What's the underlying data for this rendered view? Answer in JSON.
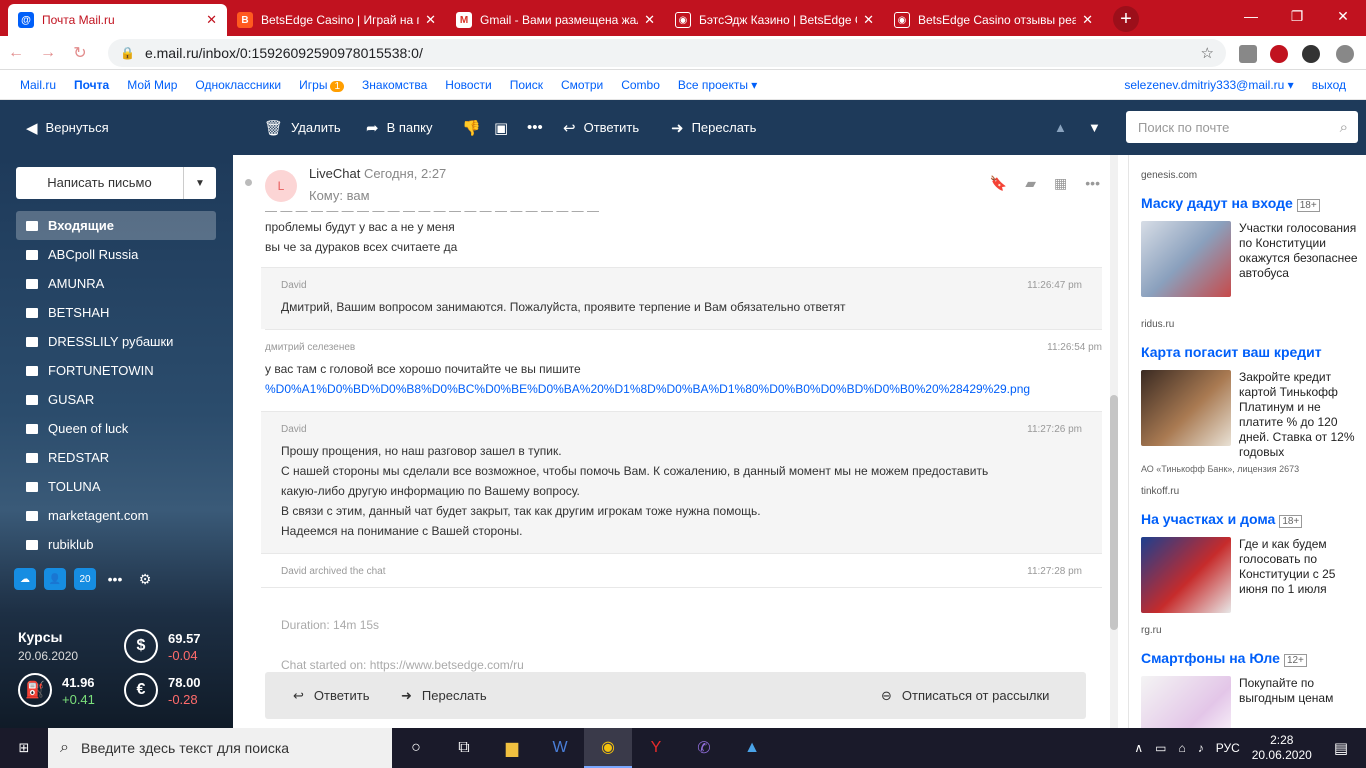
{
  "browser": {
    "tabs": [
      {
        "title": "Почта Mail.ru",
        "active": true,
        "color": "#005ff9",
        "icon": "@"
      },
      {
        "title": "BetsEdge Casino | Играй на по",
        "active": false,
        "color": "#ff5a1f",
        "icon": "B"
      },
      {
        "title": "Gmail - Вами размещена жалоб",
        "active": false,
        "color": "#ffffff",
        "icon": "M"
      },
      {
        "title": "БэтсЭдж Казино | BetsEdge Cas",
        "active": false,
        "color": "#c1121f",
        "icon": "◉"
      },
      {
        "title": "BetsEdge Casino отзывы реаль",
        "active": false,
        "color": "#c1121f",
        "icon": "◉"
      }
    ],
    "url": "e.mail.ru/inbox/0:15926092590978015538:0/"
  },
  "portal": {
    "links": [
      "Mail.ru",
      "Почта",
      "Мой Мир",
      "Одноклассники",
      "Игры",
      "Знакомства",
      "Новости",
      "Поиск",
      "Смотри",
      "Combo",
      "Все проекты ▾"
    ],
    "games_badge": "1",
    "user": "selezenev.dmitriy333@mail.ru ▾",
    "logout": "выход"
  },
  "toolbar": {
    "back": "Вернуться",
    "delete": "Удалить",
    "move": "В папку",
    "reply": "Ответить",
    "forward": "Переслать",
    "search_placeholder": "Поиск по почте"
  },
  "sidebar": {
    "compose": "Написать письмо",
    "folders": [
      "Входящие",
      "ABCpoll Russia",
      "AMUNRA",
      "BETSHAH",
      "DRESSLILY рубашки",
      "FORTUNETOWIN",
      "GUSAR",
      "Queen of luck",
      "REDSTAR",
      "TOLUNA",
      "marketagent.com",
      "rubiklub"
    ],
    "calendar_day": "20",
    "rates": {
      "title": "Курсы",
      "date": "20.06.2020",
      "usd": {
        "value": "69.57",
        "change": "-0.04"
      },
      "eur": {
        "value": "78.00",
        "change": "-0.28"
      },
      "oil": {
        "value": "41.96",
        "change": "+0.41"
      }
    }
  },
  "message": {
    "avatar": "L",
    "from": "LiveChat",
    "date": "Сегодня, 2:27",
    "to": "Кому: вам",
    "lines_top": [
      "проблемы будут у вас а не у меня",
      "вы че за дураков всех считаете да"
    ],
    "chat": [
      {
        "author": "David",
        "time": "11:26:47 pm",
        "agent": true,
        "lines": [
          "Дмитрий, Вашим вопросом занимаются. Пожалуйста, проявите терпение и Вам обязательно ответят"
        ]
      },
      {
        "author": "дмитрий селезенев",
        "time": "11:26:54 pm",
        "agent": false,
        "lines": [
          "у вас там с головой все хорошо почитайте че вы пишите"
        ],
        "link": "%D0%A1%D0%BD%D0%B8%D0%BC%D0%BE%D0%BA%20%D1%8D%D0%BA%D1%80%D0%B0%D0%BD%D0%B0%20%28429%29.png"
      },
      {
        "author": "David",
        "time": "11:27:26 pm",
        "agent": true,
        "lines": [
          "Прошу прощения, но наш разговор зашел в тупик.",
          "С нашей стороны мы сделали все возможное, чтобы помочь Вам. К сожалению, в данный момент мы не можем предоставить",
          "какую-либо другую информацию по Вашему вопросу.",
          "В связи с этим, данный чат будет закрыт, так как другим игрокам тоже нужна помощь.",
          "Надеемся на понимание с Вашей стороны."
        ]
      },
      {
        "author": "David archived the chat",
        "time": "11:27:28 pm",
        "agent": true,
        "lines": []
      }
    ],
    "duration": "Duration: 14m 15s",
    "started_on": "Chat started on: https://www.betsedge.com/ru",
    "bottom": {
      "reply": "Ответить",
      "forward": "Переслать",
      "unsubscribe": "Отписаться от рассылки"
    }
  },
  "ads": [
    {
      "source": "genesis.com",
      "title": "",
      "age": "",
      "text": ""
    },
    {
      "source": "ridus.ru",
      "title": "Маску дадут на входе",
      "age": "18+",
      "text": "Участки голосования по Конституции окажутся безопаснее автобуса"
    },
    {
      "source": "tinkoff.ru",
      "title": "Карта погасит ваш кредит",
      "age": "",
      "text": "Закройте кредит картой Тинькофф Платинум и не платите % до 120 дней. Ставка от 12% годовых",
      "note": "АО «Тинькофф Банк», лицензия 2673"
    },
    {
      "source": "rg.ru",
      "title": "На участках и дома",
      "age": "18+",
      "text": "Где и как будем голосовать по Конституции с 25 июня по 1 июля"
    },
    {
      "source": "",
      "title": "Смартфоны на Юле",
      "age": "12+",
      "text": "Покупайте по выгодным ценам"
    }
  ],
  "taskbar": {
    "search_placeholder": "Введите здесь текст для поиска",
    "lang": "РУС",
    "time": "2:28",
    "date": "20.06.2020"
  }
}
